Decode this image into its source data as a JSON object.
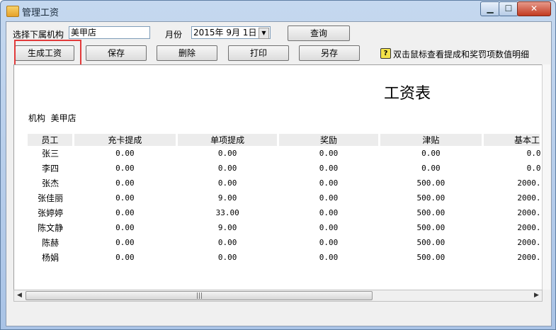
{
  "window": {
    "title": "管理工资",
    "min": "▁",
    "max": "☐",
    "close": "✕"
  },
  "toolbar": {
    "org_label": "选择下属机构",
    "org_value": "美甲店",
    "month_label": "月份",
    "month_value": "2015年 9月 1日",
    "month_dropdown": "▼",
    "query_label": "查询",
    "generate_label": "生成工资",
    "save_label": "保存",
    "delete_label": "删除",
    "print_label": "打印",
    "saveas_label": "另存",
    "help_icon": "?",
    "help_text": "双击鼠标查看提成和奖罚项数值明细"
  },
  "report": {
    "title": "工资表",
    "org_label": "机构",
    "org_value": "美甲店",
    "columns": [
      "员工",
      "充卡提成",
      "单项提成",
      "奖励",
      "津贴",
      "基本工"
    ],
    "rows": [
      [
        "张三",
        "0.00",
        "0.00",
        "0.00",
        "0.00",
        "0.0"
      ],
      [
        "李四",
        "0.00",
        "0.00",
        "0.00",
        "0.00",
        "0.0"
      ],
      [
        "张杰",
        "0.00",
        "0.00",
        "0.00",
        "500.00",
        "2000."
      ],
      [
        "张佳丽",
        "0.00",
        "9.00",
        "0.00",
        "500.00",
        "2000."
      ],
      [
        "张婷婷",
        "0.00",
        "33.00",
        "0.00",
        "500.00",
        "2000."
      ],
      [
        "陈文静",
        "0.00",
        "9.00",
        "0.00",
        "500.00",
        "2000."
      ],
      [
        "陈赫",
        "0.00",
        "0.00",
        "0.00",
        "500.00",
        "2000."
      ],
      [
        "杨娟",
        "0.00",
        "0.00",
        "0.00",
        "500.00",
        "2000."
      ]
    ]
  },
  "scrollbar": {
    "left": "◀",
    "right": "▶",
    "grip": "|||"
  }
}
